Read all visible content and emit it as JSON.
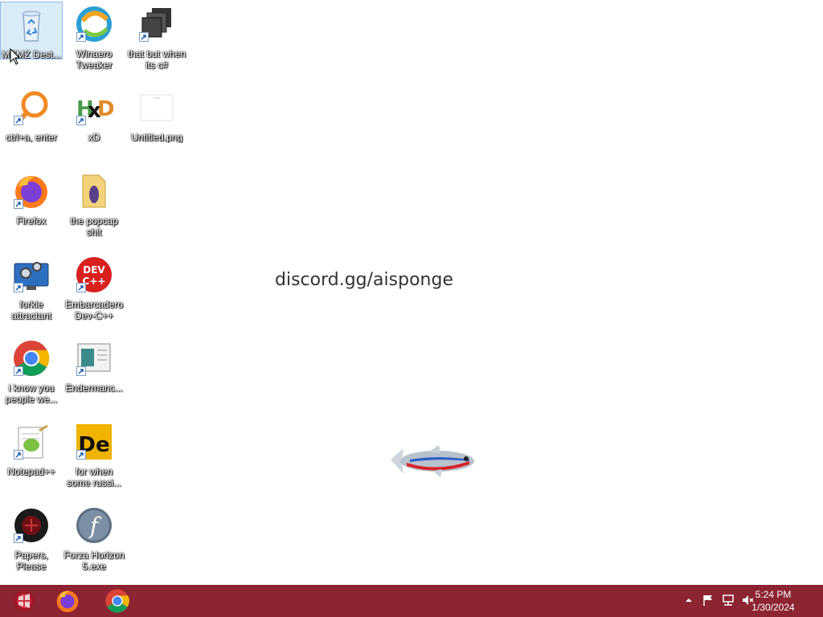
{
  "desktop": {
    "icons": [
      {
        "label": "MEMZ Dest...",
        "icon": "recycle-bin-icon"
      },
      {
        "label": "Winaero Tweaker",
        "icon": "winaero-icon"
      },
      {
        "label": "that but when its c#",
        "icon": "stacked-windows-icon"
      },
      {
        "label": "ctrl+a, enter",
        "icon": "magnifier-icon"
      },
      {
        "label": "xD",
        "icon": "hxd-icon"
      },
      {
        "label": "Untitled.png",
        "icon": "image-file-icon"
      },
      {
        "label": "Firefox",
        "icon": "firefox-icon"
      },
      {
        "label": "the popcap shit",
        "icon": "folder-icon"
      },
      {
        "label": "forkie attractant",
        "icon": "system-settings-icon"
      },
      {
        "label": "Embarcadero Dev-C++",
        "icon": "devcpp-icon"
      },
      {
        "label": "i know you people we...",
        "icon": "chrome-icon"
      },
      {
        "label": "Endermanc...",
        "icon": "window-app-icon"
      },
      {
        "label": "Notepad++",
        "icon": "notepadpp-icon"
      },
      {
        "label": "for when some russi...",
        "icon": "de-app-icon"
      },
      {
        "label": "Papers, Please",
        "icon": "papers-please-icon"
      },
      {
        "label": "Forza Horizon 5.exe",
        "icon": "flash-icon"
      }
    ],
    "wallpaper_text": "discord.gg/aisponge"
  },
  "taskbar": {
    "background": "#8c2431",
    "pinned": [
      {
        "name": "start-button",
        "icon": "start-orb-icon"
      },
      {
        "name": "firefox",
        "icon": "firefox-icon"
      },
      {
        "name": "chrome",
        "icon": "chrome-icon"
      }
    ],
    "tray": [
      "show-hidden-icons",
      "action-center-flag-icon",
      "network-icon",
      "volume-muted-icon"
    ],
    "time": "5:24 PM",
    "date": "1/30/2024"
  }
}
